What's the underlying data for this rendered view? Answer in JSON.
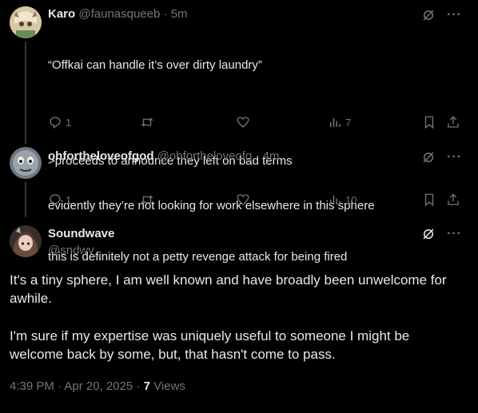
{
  "tweets": [
    {
      "name": "Karo",
      "handle": "@faunasqueeb",
      "time": "5m",
      "lines": [
        "“Offkai can handle it’s over dirty laundry”",
        ">proceeds to announce they left on bad terms",
        "this is definitely not a petty revenge attack for being fired"
      ],
      "replies": "1",
      "views": "7"
    },
    {
      "name": "ohfortheloveofgod",
      "handle": "@ohfortheloveofg",
      "time": "4m",
      "lines": [
        "evidently they’re not looking for work elsewhere in this sphere"
      ],
      "replies": "1",
      "views": "10"
    }
  ],
  "main": {
    "name": "Soundwave",
    "handle": "@sndwv_",
    "paragraph1": "It's a tiny sphere, I am well known and have broadly been unwelcome for\nawhile.",
    "paragraph2": "I'm sure if my expertise was uniquely useful to someone I might be\nwelcome back by some, but, that hasn't come to pass.",
    "timestamp": "4:39 PM · Apr 20, 2025 · ",
    "views_count": "7",
    "views_label": " Views"
  },
  "separator": " · ",
  "icons": {
    "reply": "reply-icon",
    "retweet": "retweet-icon",
    "like": "heart-icon",
    "views": "analytics-icon",
    "bookmark": "bookmark-icon",
    "share": "share-icon",
    "grok": "grok-icon",
    "more": "more-icon"
  },
  "colors": {
    "background": "#000000",
    "text": "#e7e9ea",
    "muted": "#71767b",
    "line": "#333639"
  },
  "more_glyph": "···"
}
